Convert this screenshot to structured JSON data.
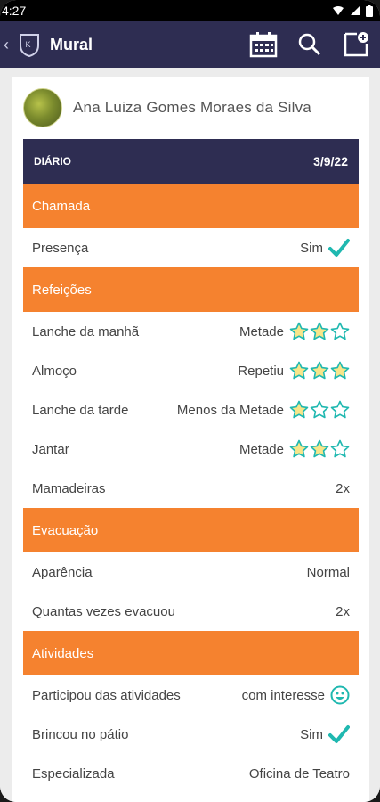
{
  "status": {
    "time": "4:27"
  },
  "appbar": {
    "title": "Mural"
  },
  "profile": {
    "name": "Ana Luiza Gomes Moraes da Silva"
  },
  "diary": {
    "label": "DIÁRIO",
    "date": "3/9/22"
  },
  "sections": {
    "chamada": {
      "title": "Chamada",
      "rows": [
        {
          "label": "Presença",
          "value": "Sim"
        }
      ]
    },
    "refeicoes": {
      "title": "Refeições",
      "rows": [
        {
          "label": "Lanche da manhã",
          "value": "Metade",
          "stars": 2
        },
        {
          "label": "Almoço",
          "value": "Repetiu",
          "stars": 3
        },
        {
          "label": "Lanche da tarde",
          "value": "Menos da Metade",
          "stars": 1
        },
        {
          "label": "Jantar",
          "value": "Metade",
          "stars": 2
        },
        {
          "label": "Mamadeiras",
          "value": "2x"
        }
      ]
    },
    "evacuacao": {
      "title": "Evacuação",
      "rows": [
        {
          "label": "Aparência",
          "value": "Normal"
        },
        {
          "label": "Quantas vezes evacuou",
          "value": "2x"
        }
      ]
    },
    "atividades": {
      "title": "Atividades",
      "rows": [
        {
          "label": "Participou das atividades",
          "value": "com interesse"
        },
        {
          "label": "Brincou no pátio",
          "value": "Sim"
        },
        {
          "label": "Especializada",
          "value": "Oficina de Teatro"
        }
      ]
    }
  },
  "icons": {
    "calendar": "calendar-icon",
    "search": "search-icon",
    "new_post": "new-post-icon",
    "check": "check-icon",
    "star": "star-icon",
    "smiley": "smiley-icon"
  },
  "colors": {
    "navy": "#2e2d52",
    "orange": "#f5822f",
    "teal": "#1fb8b0",
    "star_fill": "#f7e58a"
  }
}
